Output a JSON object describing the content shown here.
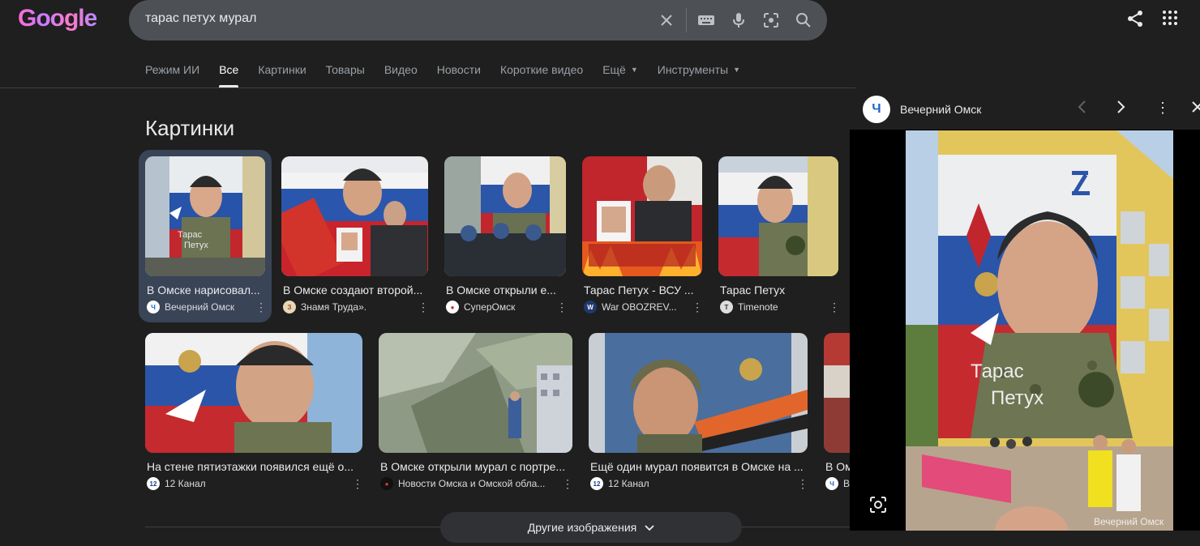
{
  "logo": "Google",
  "search": {
    "query": "тарас петух мурал",
    "icons": [
      "close-icon",
      "keyboard-icon",
      "mic-icon",
      "lens-icon",
      "search-icon"
    ]
  },
  "header_icons": [
    "share-icon",
    "apps-icon"
  ],
  "tabs": [
    {
      "label": "Режим ИИ"
    },
    {
      "label": "Все"
    },
    {
      "label": "Картинки"
    },
    {
      "label": "Товары"
    },
    {
      "label": "Видео"
    },
    {
      "label": "Новости"
    },
    {
      "label": "Короткие видео"
    },
    {
      "label": "Ещё"
    },
    {
      "label": "Инструменты"
    }
  ],
  "active_tab": "Все",
  "images_section": {
    "title": "Картинки",
    "row1": [
      {
        "title": "В Омске нарисовал...",
        "source": "Вечерний Омск"
      },
      {
        "title": "В Омске создают второй...",
        "source": "Знамя Труда»."
      },
      {
        "title": "В Омске открыли е...",
        "source": "СуперОмск"
      },
      {
        "title": "Тарас Петух - ВСУ ...",
        "source": "War OBOZREV..."
      },
      {
        "title": "Тарас Петух",
        "source": "Timenote"
      }
    ],
    "row2": [
      {
        "title": "На стене пятиэтажки появился ещё о...",
        "source": "12 Канал"
      },
      {
        "title": "В Омске открыли мурал с портре...",
        "source": "Новости Омска и Омской обла..."
      },
      {
        "title": "Ещё один мурал появится в Омске на ...",
        "source": "12 Канал"
      },
      {
        "title": "В Ом",
        "source": "В"
      }
    ],
    "mural_text": [
      "Тарас",
      "Петух"
    ],
    "more_button": "Другие изображения"
  },
  "side_panel": {
    "source": "Вечерний Омск",
    "favicon_letter": "Ч",
    "mural_text": [
      "Тарас",
      "Петух"
    ],
    "watermark": "Вечерний Омск"
  },
  "colors": {
    "background": "#1f1f1f",
    "selected": "#394457",
    "search_box": "#4d5156"
  }
}
